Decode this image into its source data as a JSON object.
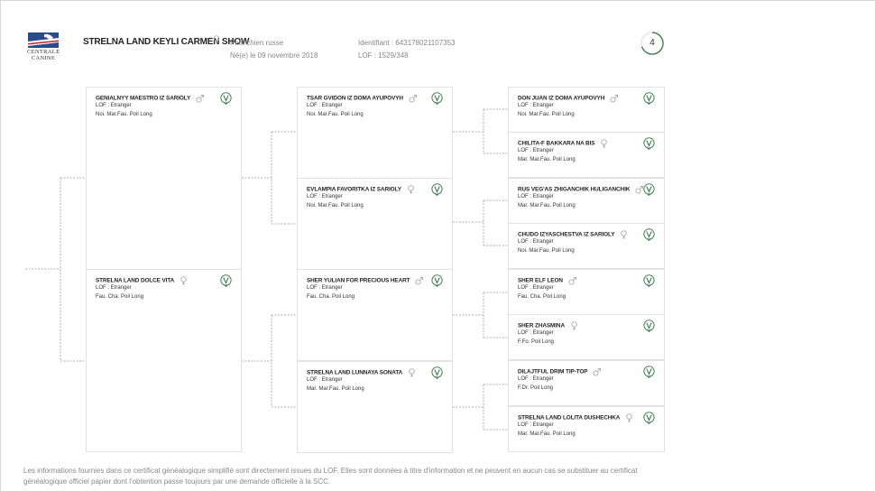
{
  "dog": {
    "name": "STRELNA LAND KEYLI CARMEN SHOW",
    "sex": "female",
    "breed": "Petit chien russe",
    "born": "Né(e) le 09 novembre 2018",
    "identifier": "Identifiant : 643178021107353",
    "lof": "LOF : 1529/348",
    "generations": "4"
  },
  "logo": {
    "line1": "CENTRALE",
    "line2": "CANINE"
  },
  "pedigree": {
    "parents": [
      {
        "name": "GENIALNYY MAESTRO IZ SARIOLY",
        "sex": "male",
        "lof": "LOF : Etranger",
        "details": "Noi. Mar.Fau. Poil Long"
      },
      {
        "name": "STRELNA LAND DOLCE VITA",
        "sex": "female",
        "lof": "LOF : Etranger",
        "details": "Fau. Cha. Poil Long"
      }
    ],
    "grandparents": [
      {
        "name": "TSAR GVIDON IZ DOMA AYUPOVYH",
        "sex": "male",
        "lof": "LOF : Etranger",
        "details": "Noi. Mar.Fau. Poil Long"
      },
      {
        "name": "EVLAMPIA FAVORITKA IZ SARIOLY",
        "sex": "female",
        "lof": "LOF : Etranger",
        "details": "Noi. Mar.Fau. Poil Long"
      },
      {
        "name": "SHER YULIAN FOR PRECIOUS HEART",
        "sex": "male",
        "lof": "LOF : Etranger",
        "details": "Fau. Cha. Poil Long"
      },
      {
        "name": "STRELNA LAND LUNNAYA SONATA",
        "sex": "female",
        "lof": "LOF : Etranger",
        "details": "Mar. Mar.Fau. Poil Long"
      }
    ],
    "great_grandparents": [
      {
        "name": "DON JUAN IZ DOMA AYUPOVYH",
        "sex": "male",
        "lof": "LOF : Etranger",
        "details": "Noi. Mar.Fau. Poil Long"
      },
      {
        "name": "CHILITA-F BAKKARA NA BIS",
        "sex": "female",
        "lof": "LOF : Etranger",
        "details": "Mar. Mar.Fau. Poil Long"
      },
      {
        "name": "RUS VEG'AS ZHIGANCHIK HULIGANCHIK",
        "sex": "male",
        "lof": "LOF : Etranger",
        "details": "Mar. Mar.Fau. Poil Long"
      },
      {
        "name": "CHUDO IZYASCHESTVA IZ SARIOLY",
        "sex": "female",
        "lof": "LOF : Etranger",
        "details": "Noi. Mar.Fau. Poil Long"
      },
      {
        "name": "SHER ELF LEON",
        "sex": "male",
        "lof": "LOF : Etranger",
        "details": "Fau. Cha. Poil Long"
      },
      {
        "name": "SHER ZHASMINA",
        "sex": "female",
        "lof": "LOF : Etranger",
        "details": "F.Fo. Poil Long"
      },
      {
        "name": "DILAJTFUL DRIM TIP-TOP",
        "sex": "male",
        "lof": "LOF : Etranger",
        "details": "F.Dr. Poil Long"
      },
      {
        "name": "STRELNA LAND LOLITA DUSHECHKA",
        "sex": "female",
        "lof": "LOF : Etranger",
        "details": "Mar. Mar.Fau. Poil Long"
      }
    ]
  },
  "footer": "Les informations fournies dans ce certificat généalogique simplifié sont directement issues du LOF. Elles sont données à titre d'information et ne peuvent en aucun cas se substituer au certificat généalogique officiel papier dont l'obtention passe toujours par une demande officielle à la SCC.",
  "colors": {
    "accent": "#3f7f4f",
    "line": "#999999",
    "border": "#e2e2e2",
    "flag_blue": "#2b4a8c",
    "flag_red": "#c8202f"
  },
  "icons": {
    "lof": "lof-badge-icon",
    "male": "male-icon",
    "female": "female-icon"
  }
}
